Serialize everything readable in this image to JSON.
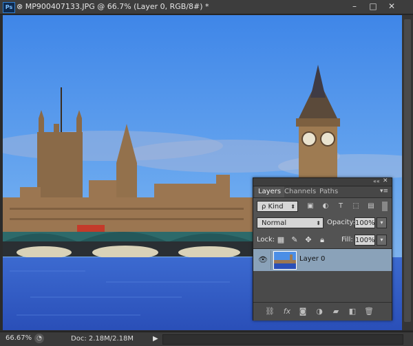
{
  "window": {
    "app_badge": "Ps",
    "title": "MP900407133.JPG @ 66.7% (Layer 0, RGB/8#) *",
    "controls": {
      "minimize": "–",
      "maximize": "□",
      "close": "✕"
    }
  },
  "status": {
    "zoom": "66.67%",
    "doc_size": "Doc: 2.18M/2.18M",
    "arrow": "▶"
  },
  "layers_panel": {
    "collapse_glyph": "««",
    "close_glyph": "✕",
    "menu_glyph": "▾≡",
    "tabs": [
      "Layers",
      "Channels",
      "Paths"
    ],
    "active_tab": "Layers",
    "filter": {
      "kind_label": "ρ Kind",
      "icons": [
        "image-filter-icon",
        "adjustment-filter-icon",
        "type-filter-icon",
        "shape-filter-icon",
        "smart-object-filter-icon"
      ]
    },
    "blend_mode": "Normal",
    "opacity_label": "Opacity:",
    "opacity": "100%",
    "lock_label": "Lock:",
    "lock_icons": [
      "lock-transparent-pixels-icon",
      "lock-image-pixels-icon",
      "lock-position-icon",
      "lock-all-icon"
    ],
    "fill_label": "Fill:",
    "fill": "100%",
    "layers": [
      {
        "name": "Layer 0",
        "visible": true,
        "selected": true
      }
    ],
    "bottom_icons": [
      "link-layers-icon",
      "fx-icon",
      "add-mask-icon",
      "new-adjustment-icon",
      "new-group-icon",
      "new-layer-icon",
      "delete-layer-icon"
    ]
  }
}
